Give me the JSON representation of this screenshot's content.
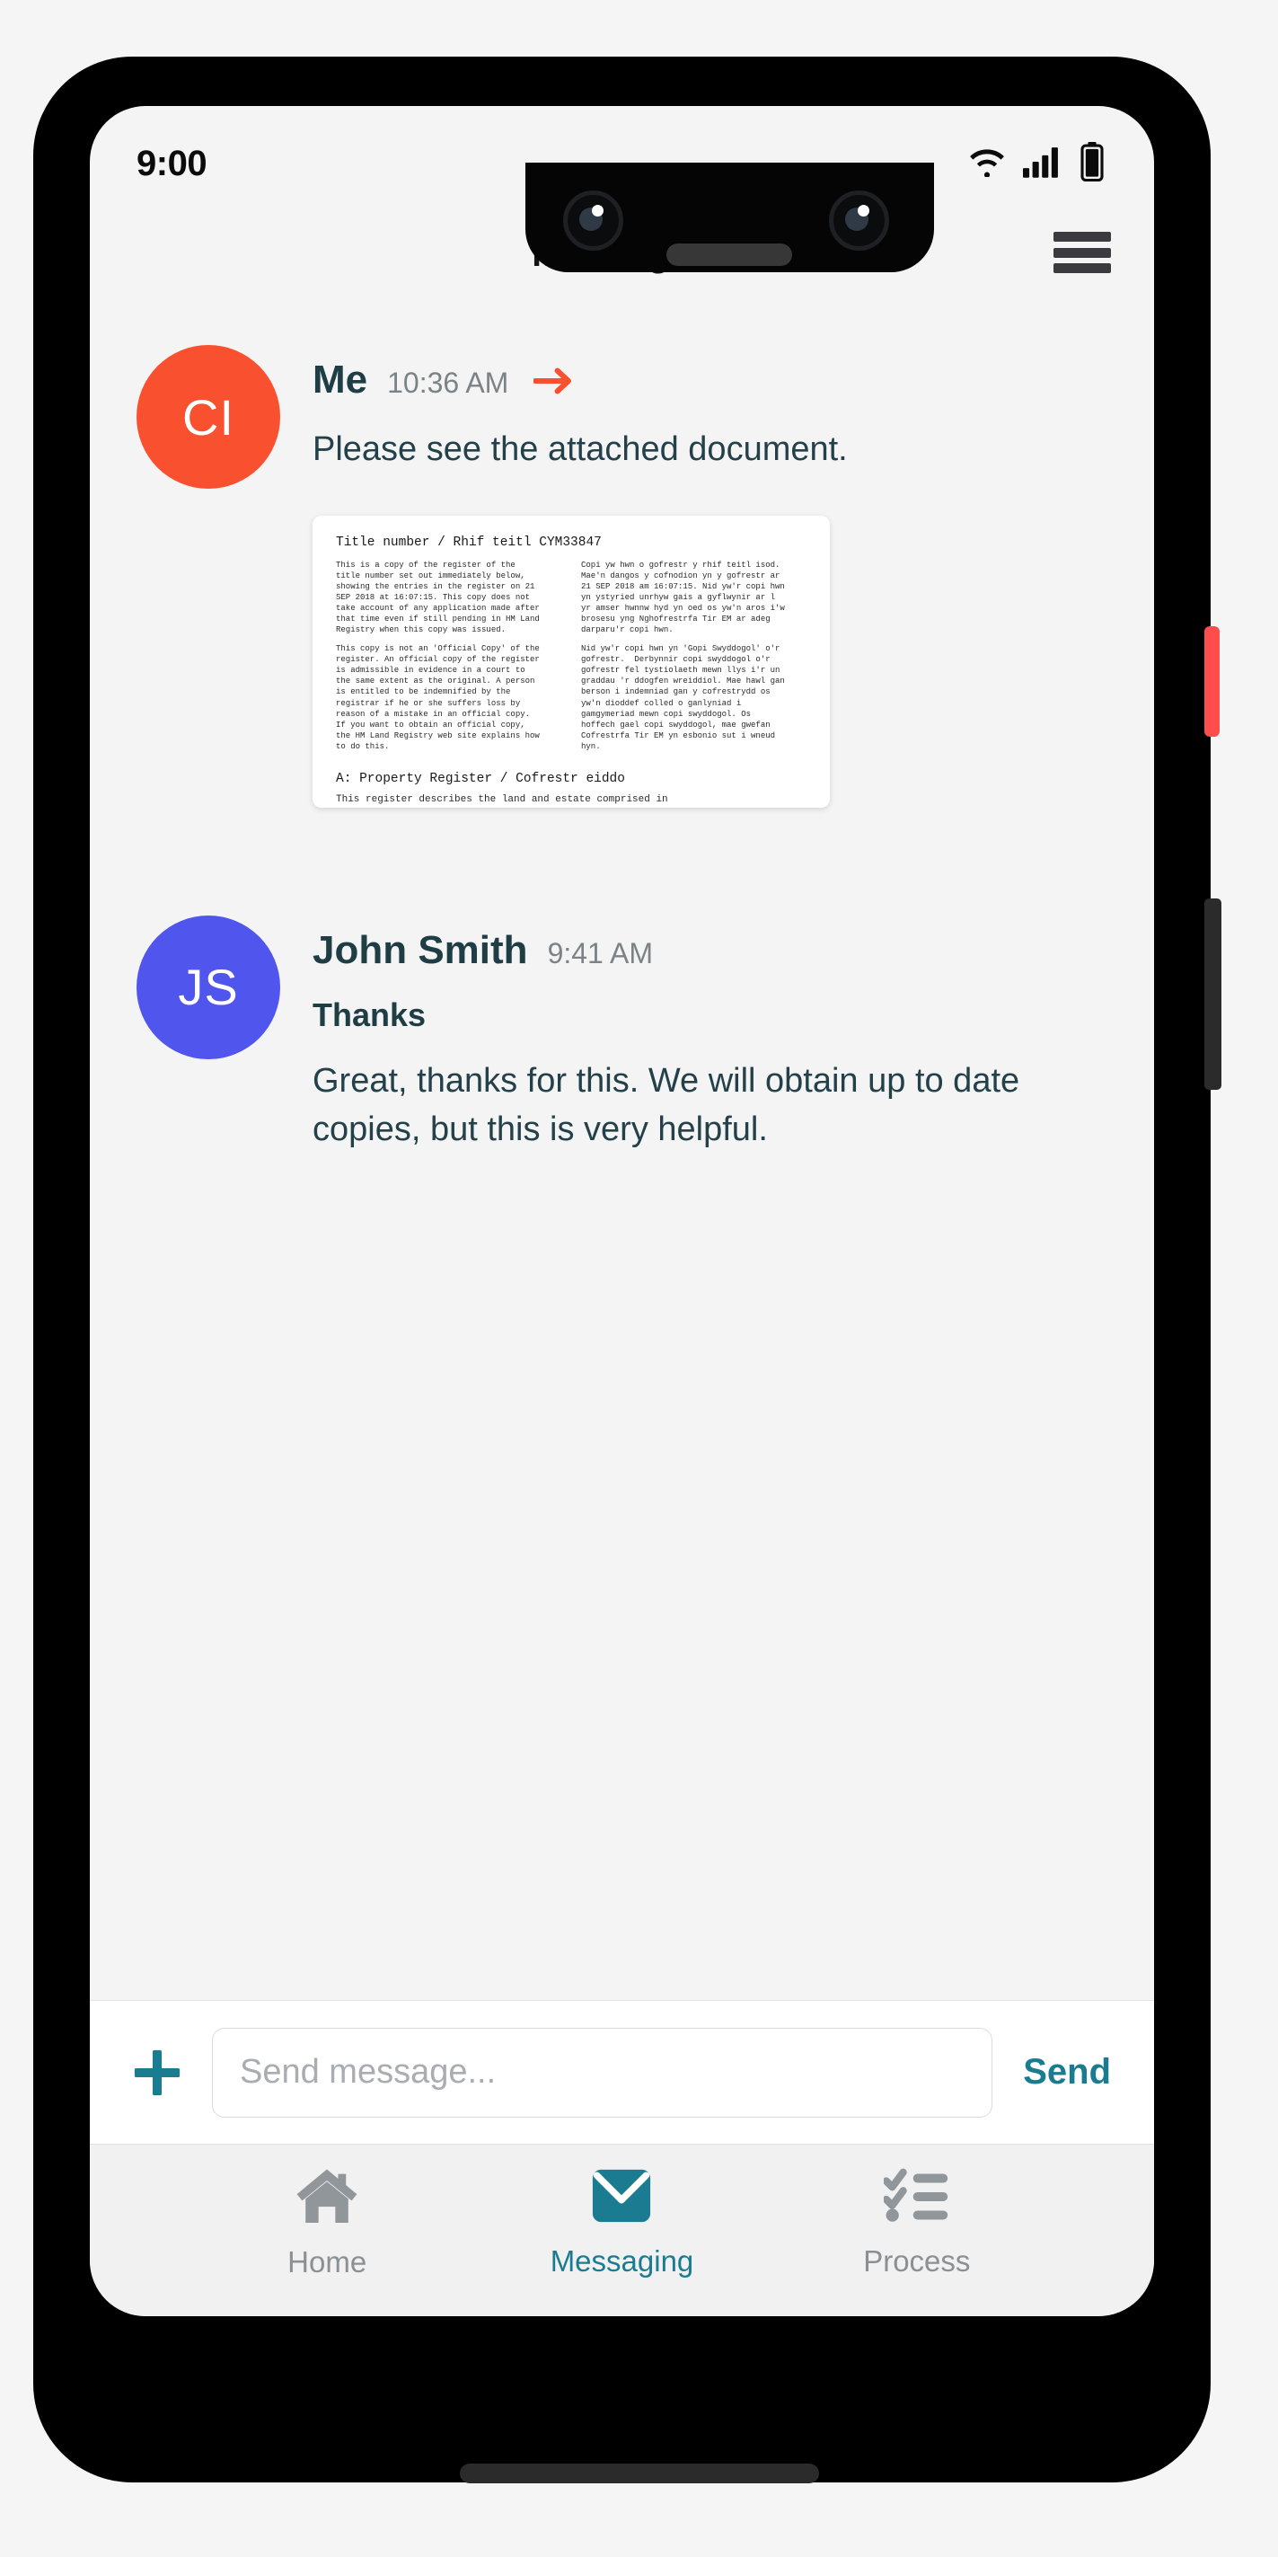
{
  "status_bar": {
    "time": "9:00",
    "icons": [
      "wifi-icon",
      "cellular-signal-icon",
      "battery-icon"
    ]
  },
  "header": {
    "title": "Messages",
    "menu_icon": "hamburger-menu-icon"
  },
  "messages": [
    {
      "avatar_initials": "CI",
      "avatar_color": "#f9502f",
      "sender": "Me",
      "time": "10:36 AM",
      "sent_indicator": "arrow-right-icon",
      "sent_indicator_color": "#f9502f",
      "subject": "",
      "text": "Please see the attached document.",
      "attachment": {
        "type": "document-thumbnail",
        "title": "Title number / Rhif teitl  CYM33847",
        "columns": [
          {
            "paragraphs": [
              "This is a copy of the register of the\ntitle number set out immediately below,\nshowing the entries in the register on 21\nSEP 2018 at 16:07:15. This copy does not\ntake account of any application made after\nthat time even if still pending in HM Land\nRegistry when this copy was issued.",
              "This copy is not an 'Official Copy' of the\nregister. An official copy of the register\nis admissible in evidence in a court to\nthe same extent as the original. A person\nis entitled to be indemnified by the\nregistrar if he or she suffers loss by\nreason of a mistake in an official copy.\nIf you want to obtain an official copy,\nthe HM Land Registry web site explains how\nto do this."
            ]
          },
          {
            "paragraphs": [
              "Copi yw hwn o gofrestr y rhif teitl isod.\nMae'n dangos y cofnodion yn y gofrestr ar\n21 SEP 2018 am 16:07:15. Nid yw'r copi hwn\nyn ystyried unrhyw gais a gyflwynir ar l\nyr amser hwnnw hyd yn oed os yw'n aros i'w\nbrosesu yng Nghofrestrfa Tir EM ar adeg\ndarparu'r copi hwn.",
              "Nid yw'r copi hwn yn 'Gopi Swyddogol' o'r\ngofrestr.  Derbynnir copi swyddogol o'r\ngofrestr fel tystiolaeth mewn llys i'r un\ngraddau 'r ddogfen wreiddiol. Mae hawl gan\nberson i indemniad gan y cofrestrydd os\nyw'n dioddef colled o ganlyniad i\ngamgymeriad mewn copi swyddogol. Os\nhoffech gael copi swyddogol, mae gwefan\nCofrestrfa Tir EM yn esbonio sut i wneud\nhyn."
            ]
          }
        ],
        "section_title": "A: Property Register / Cofrestr eiddo",
        "section_body": "This register describes the land and estate comprised in\nthe title. Except as mentioned below, the title includes\nany legal easements granted by the registered lease but\nis subject to any rights that it reserves, so far as"
      }
    },
    {
      "avatar_initials": "JS",
      "avatar_color": "#4f55ed",
      "sender": "John Smith",
      "time": "9:41 AM",
      "subject": "Thanks",
      "text": "Great, thanks for this. We will obtain up to date copies, but this is very helpful."
    }
  ],
  "composer": {
    "attach_icon": "plus-icon",
    "input_value": "",
    "placeholder": "Send message...",
    "send_label": "Send",
    "accent_color": "#1b7c91"
  },
  "bottom_nav": {
    "items": [
      {
        "label": "Home",
        "icon": "home-icon",
        "active": false
      },
      {
        "label": "Messaging",
        "icon": "envelope-icon",
        "active": true
      },
      {
        "label": "Process",
        "icon": "checklist-icon",
        "active": false
      }
    ],
    "active_color": "#1b7c91",
    "inactive_color": "#8b9093"
  }
}
